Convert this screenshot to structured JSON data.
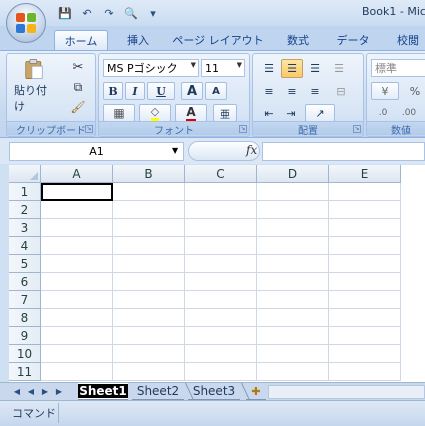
{
  "window": {
    "title": "Book1 - Mic"
  },
  "quick_access": [
    {
      "name": "save-icon",
      "glyph": "💾"
    },
    {
      "name": "undo-icon",
      "glyph": "↶"
    },
    {
      "name": "redo-icon",
      "glyph": "↷"
    },
    {
      "name": "print-preview-icon",
      "glyph": "🔍"
    },
    {
      "name": "customize-qat-icon",
      "glyph": "▾"
    }
  ],
  "tabs": [
    {
      "label": "ホーム",
      "active": true
    },
    {
      "label": "挿入"
    },
    {
      "label": "ページ レイアウト"
    },
    {
      "label": "数式"
    },
    {
      "label": "データ"
    },
    {
      "label": "校閲"
    }
  ],
  "ribbon": {
    "clipboard": {
      "label": "クリップボード",
      "paste_label": "貼り付け"
    },
    "font": {
      "label": "フォント",
      "font_name": "MS Pゴシック",
      "font_size": "11",
      "bold": "B",
      "italic": "I",
      "underline": "U",
      "grow": "A",
      "shrink": "A",
      "phonetic": "亜"
    },
    "alignment": {
      "label": "配置"
    },
    "number": {
      "label": "数値",
      "format": "標準",
      "percent": "%"
    }
  },
  "formula_bar": {
    "name_box": "A1",
    "fx_label": "fx",
    "formula": ""
  },
  "grid": {
    "columns": [
      "A",
      "B",
      "C",
      "D",
      "E"
    ],
    "rows": [
      "1",
      "2",
      "3",
      "4",
      "5",
      "6",
      "7",
      "8",
      "9",
      "10",
      "11"
    ],
    "selected_cell": "A1"
  },
  "sheets": [
    {
      "label": "Sheet1",
      "active": true
    },
    {
      "label": "Sheet2"
    },
    {
      "label": "Sheet3"
    }
  ],
  "status": {
    "mode": "コマンド"
  },
  "colors": {
    "accent": "#15428b",
    "ribbon_bg": "#c7d9ef",
    "gridline": "#d0d7e5",
    "selection": "#000000"
  }
}
